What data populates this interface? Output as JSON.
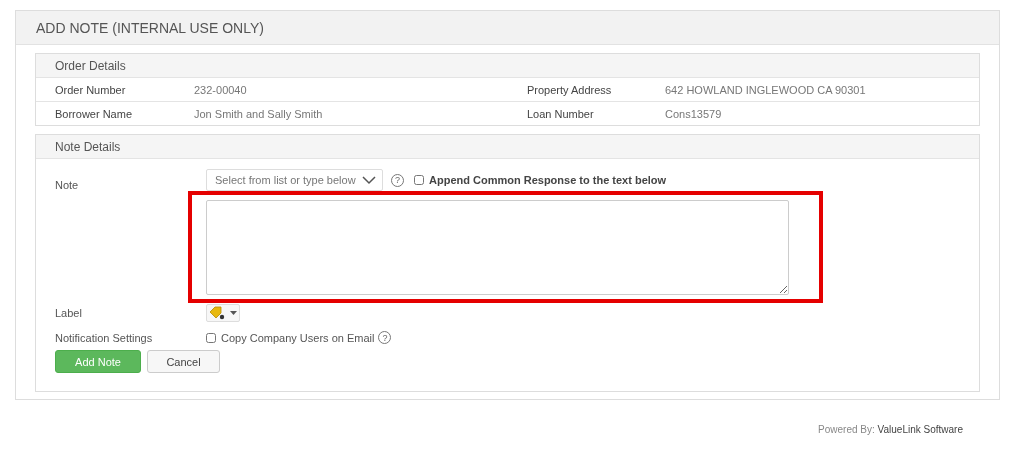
{
  "panel": {
    "title": "ADD NOTE (INTERNAL USE ONLY)"
  },
  "order_details": {
    "title": "Order Details",
    "rows": [
      {
        "label_1": "Order Number",
        "value_1": "232-00040",
        "label_2": "Property Address",
        "value_2": "642 HOWLAND INGLEWOOD CA 90301"
      },
      {
        "label_1": "Borrower Name",
        "value_1": "Jon Smith and Sally Smith",
        "label_2": "Loan Number",
        "value_2": "Cons13579"
      }
    ]
  },
  "note_details": {
    "title": "Note Details",
    "note": {
      "label": "Note",
      "select_placeholder": "Select from list or type below",
      "help": "?",
      "append_checkbox": {
        "label": "Append Common Response to the text below",
        "checked": false
      }
    },
    "label": {
      "label": "Label"
    },
    "notification": {
      "label": "Notification Settings",
      "checkbox": {
        "label": "Copy Company Users on Email",
        "checked": false
      },
      "help": "?"
    },
    "buttons": [
      {
        "label": "Add Note",
        "kind": "primary"
      },
      {
        "label": "Cancel",
        "kind": "secondary"
      }
    ]
  },
  "footer": {
    "prefix": "Powered By:",
    "brand": "ValueLink Software"
  }
}
